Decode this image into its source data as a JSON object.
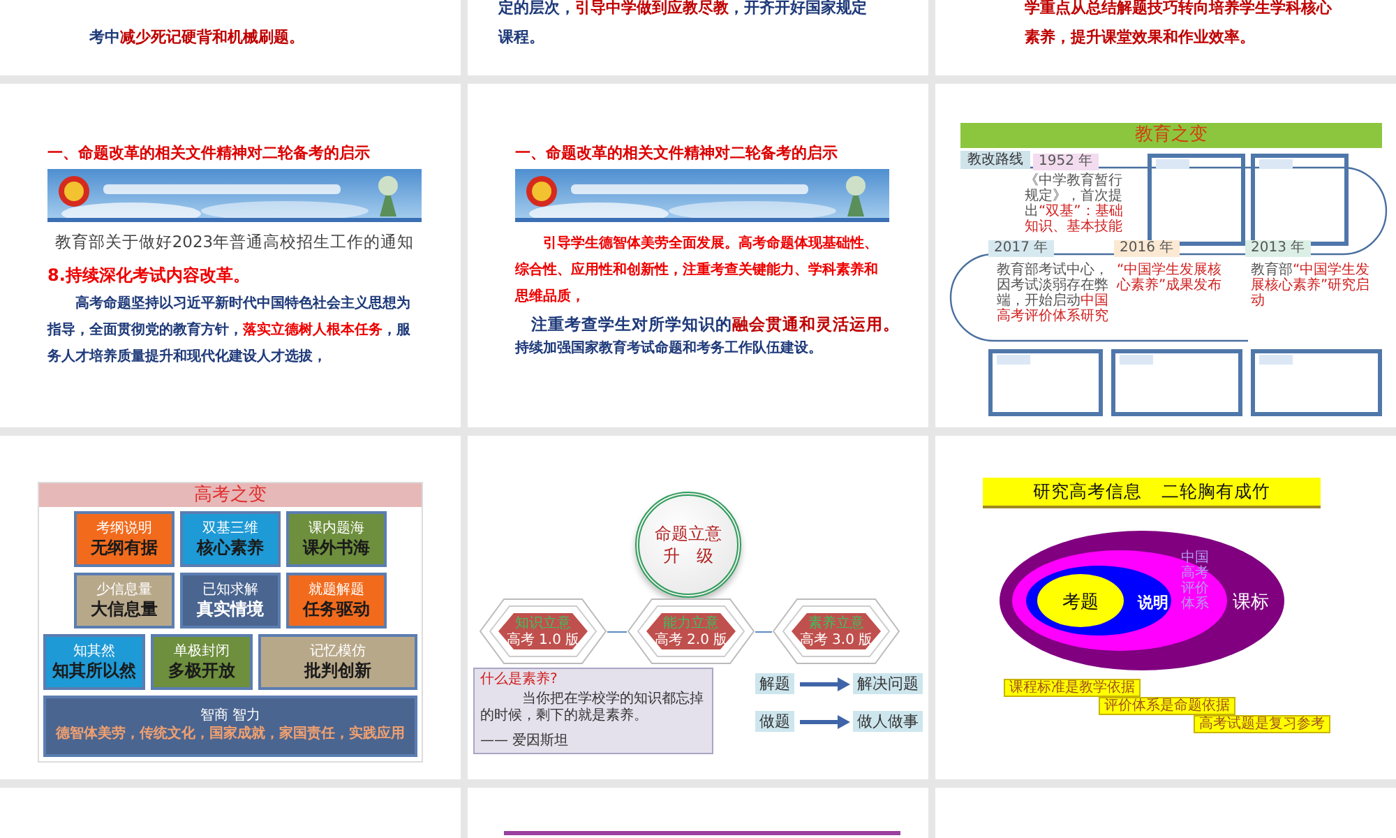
{
  "slides": [
    {
      "kind": "text",
      "paragraphs": [
        {
          "kind": "body",
          "parts": [
            {
              "text": "考中",
              "highlight": false
            },
            {
              "text": "减少死记硬背和机械刷题。",
              "highlight": true
            }
          ]
        }
      ]
    },
    {
      "kind": "text",
      "paragraphs": [
        {
          "kind": "body",
          "parts": [
            {
              "text": "定的层次，",
              "highlight": false
            },
            {
              "text": "引导中学做到应教尽教",
              "highlight": true
            },
            {
              "text": "，开齐开好国家规定课程。",
              "highlight": false
            }
          ]
        }
      ]
    },
    {
      "kind": "text",
      "paragraphs": [
        {
          "kind": "body",
          "parts": [
            {
              "text": "学重点从总结解题技巧转向培养学生学科核心素养，提升课堂效果和作业效率。",
              "highlight": true
            }
          ]
        }
      ]
    },
    {
      "kind": "notice",
      "title": "一、命题改革的相关文件精神对二轮备考的启示",
      "notice": "教育部关于做好2023年普通高校招生工作的通知",
      "heading": "8.持续深化考试内容改革。",
      "paragraphs": [
        {
          "kind": "body",
          "parts": [
            {
              "text": "高考命题坚持以习近平新时代中国特色社会主义思想为指导，全面贯彻党的教育方针，",
              "highlight": false
            },
            {
              "text": "落实立德树人根本任务",
              "highlight": true
            },
            {
              "text": "，服务人才培养质量提升和现代化建设人才选拔，",
              "highlight": false
            }
          ]
        }
      ]
    },
    {
      "kind": "notice",
      "title": "一、命题改革的相关文件精神对二轮备考的启示",
      "paragraphs": [
        {
          "kind": "body",
          "parts": [
            {
              "text": "引导学生德智体美劳全面发展。高考命题体现基础性、综合性、应用性和创新性，注重考查关键能力、学科素养和思维品质，",
              "highlight": true
            }
          ]
        },
        {
          "kind": "lead",
          "parts": [
            {
              "text": "注重考查学生对所学知识的",
              "highlight": false
            },
            {
              "text": "融会贯通和灵活运用。",
              "highlight": true
            }
          ]
        },
        {
          "kind": "note",
          "parts": [
            {
              "text": "持续加强国家教育考试命题和考务工作队伍建设。",
              "highlight": false
            }
          ]
        }
      ]
    },
    {
      "kind": "timeline",
      "title": "教育之变",
      "route_label": "教改路线",
      "events": [
        {
          "year": "1952 年",
          "color": "#f3dcef",
          "parts": [
            {
              "text": "《中学教育暂行规定》，首次提出",
              "highlight": false
            },
            {
              "text": "“双基”：基础知识、基本技能",
              "highlight": true
            }
          ]
        },
        {
          "year": "2017 年",
          "color": "#d7e9f0",
          "parts": [
            {
              "text": "教育部考试中心，因考试淡弱存在弊端，开始启动",
              "highlight": false
            },
            {
              "text": "中国高考评价体系研究",
              "highlight": true
            }
          ]
        },
        {
          "year": "2016 年",
          "color": "#fbe9d3",
          "parts": [
            {
              "text": "“中国学生发展核心素养”成果发布",
              "highlight": true
            }
          ]
        },
        {
          "year": "2013 年",
          "color": "#dcefe6",
          "parts": [
            {
              "text": "教育部",
              "highlight": false
            },
            {
              "text": "“中国学生发展核心素养”研究启动",
              "highlight": true
            }
          ]
        }
      ]
    },
    {
      "kind": "grid",
      "title": "高考之变",
      "rows": [
        [
          {
            "kind": "tile",
            "label": "考纲说明",
            "text": "无纲有据",
            "color": "#f26b1d"
          },
          {
            "kind": "tile",
            "label": "双基三维",
            "text": "核心素养",
            "color": "#1e9ad6"
          },
          {
            "kind": "tile",
            "label": "课内题海",
            "text": "课外书海",
            "color": "#6e8f3d"
          }
        ],
        [
          {
            "kind": "tile",
            "label": "少信息量",
            "text": "大信息量",
            "color": "#b8a88a"
          },
          {
            "kind": "tile",
            "label": "已知求解",
            "text": "真实情境",
            "color": "#4a6590"
          },
          {
            "kind": "tile",
            "label": "就题解题",
            "text": "任务驱动",
            "color": "#f26b1d"
          }
        ],
        [
          {
            "kind": "tile",
            "label": "知其然",
            "text": "知其所以然",
            "color": "#1e9ad6"
          },
          {
            "kind": "tile",
            "label": "单极封闭",
            "text": "多极开放",
            "color": "#6e8f3d"
          },
          {
            "kind": "tile",
            "label": "记忆模仿",
            "text": "批判创新",
            "color": "#b8a88a"
          }
        ],
        [
          {
            "kind": "wide",
            "label": "智商 智力",
            "text": "德智体美劳，传统文化，国家成就，家国责任，实践应用",
            "color": "#4a6590"
          }
        ]
      ]
    },
    {
      "kind": "levels",
      "circle": [
        "命题立意",
        "升　级"
      ],
      "stages": [
        {
          "title": "知识立意",
          "subtitle": "高考 1.0 版"
        },
        {
          "title": "能力立意",
          "subtitle": "高考 2.0 版"
        },
        {
          "title": "素养立意",
          "subtitle": "高考 3.0 版"
        }
      ],
      "quote": {
        "title": "什么是素养?",
        "text": "当你把在学校学的知识都忘掉的时候，剩下的就是素养。",
        "author": "—— 爱因斯坦"
      },
      "mappings": [
        {
          "from": "解题",
          "to": "解决问题"
        },
        {
          "from": "做题",
          "to": "做人做事"
        }
      ]
    },
    {
      "kind": "rings",
      "title": [
        "研究高考信息",
        "二轮胸有成竹"
      ],
      "rings": [
        "考题",
        "说明",
        "中国高考评价体系",
        "课标"
      ],
      "tags": [
        "课程标准是教学依据",
        "评价体系是命题依据",
        "高考试题是复习参考"
      ]
    },
    {
      "kind": "blank"
    },
    {
      "kind": "band"
    },
    {
      "kind": "blank"
    }
  ]
}
